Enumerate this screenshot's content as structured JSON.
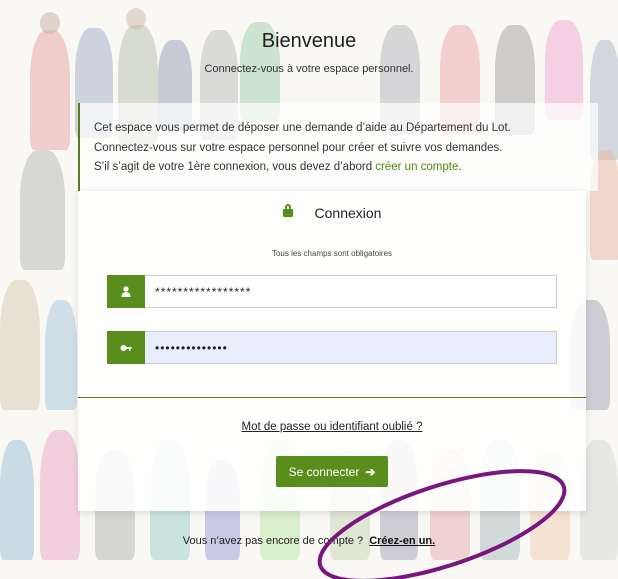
{
  "header": {
    "title": "Bienvenue",
    "subtitle": "Connectez-vous à votre espace personnel."
  },
  "intro": {
    "line1": "Cet espace vous permet de déposer une demande d’aide au Département du Lot.",
    "line2": "Connectez-vous sur votre espace personnel pour créer et suivre vos demandes.",
    "line3_prefix": "S’il s’agit de votre 1ère connexion, vous devez d’abord ",
    "line3_link": "créer un compte",
    "line3_suffix": "."
  },
  "login": {
    "title": "Connexion",
    "required_note": "Tous les champs sont obligatoires",
    "username_value": "*****************",
    "password_value": "••••••••••••••",
    "forgot_link": "Mot de passe ou identifiant oublié ?",
    "submit_label": "Se connecter"
  },
  "footer": {
    "question": "Vous n’avez pas encore de compte ?",
    "signup_link": "Créez-en un."
  },
  "colors": {
    "accent": "#5a8e1c",
    "annotation": "#7a1680"
  },
  "icons": {
    "lock": "lock-icon",
    "user": "user-icon",
    "key": "key-icon",
    "login": "sign-in-icon"
  }
}
